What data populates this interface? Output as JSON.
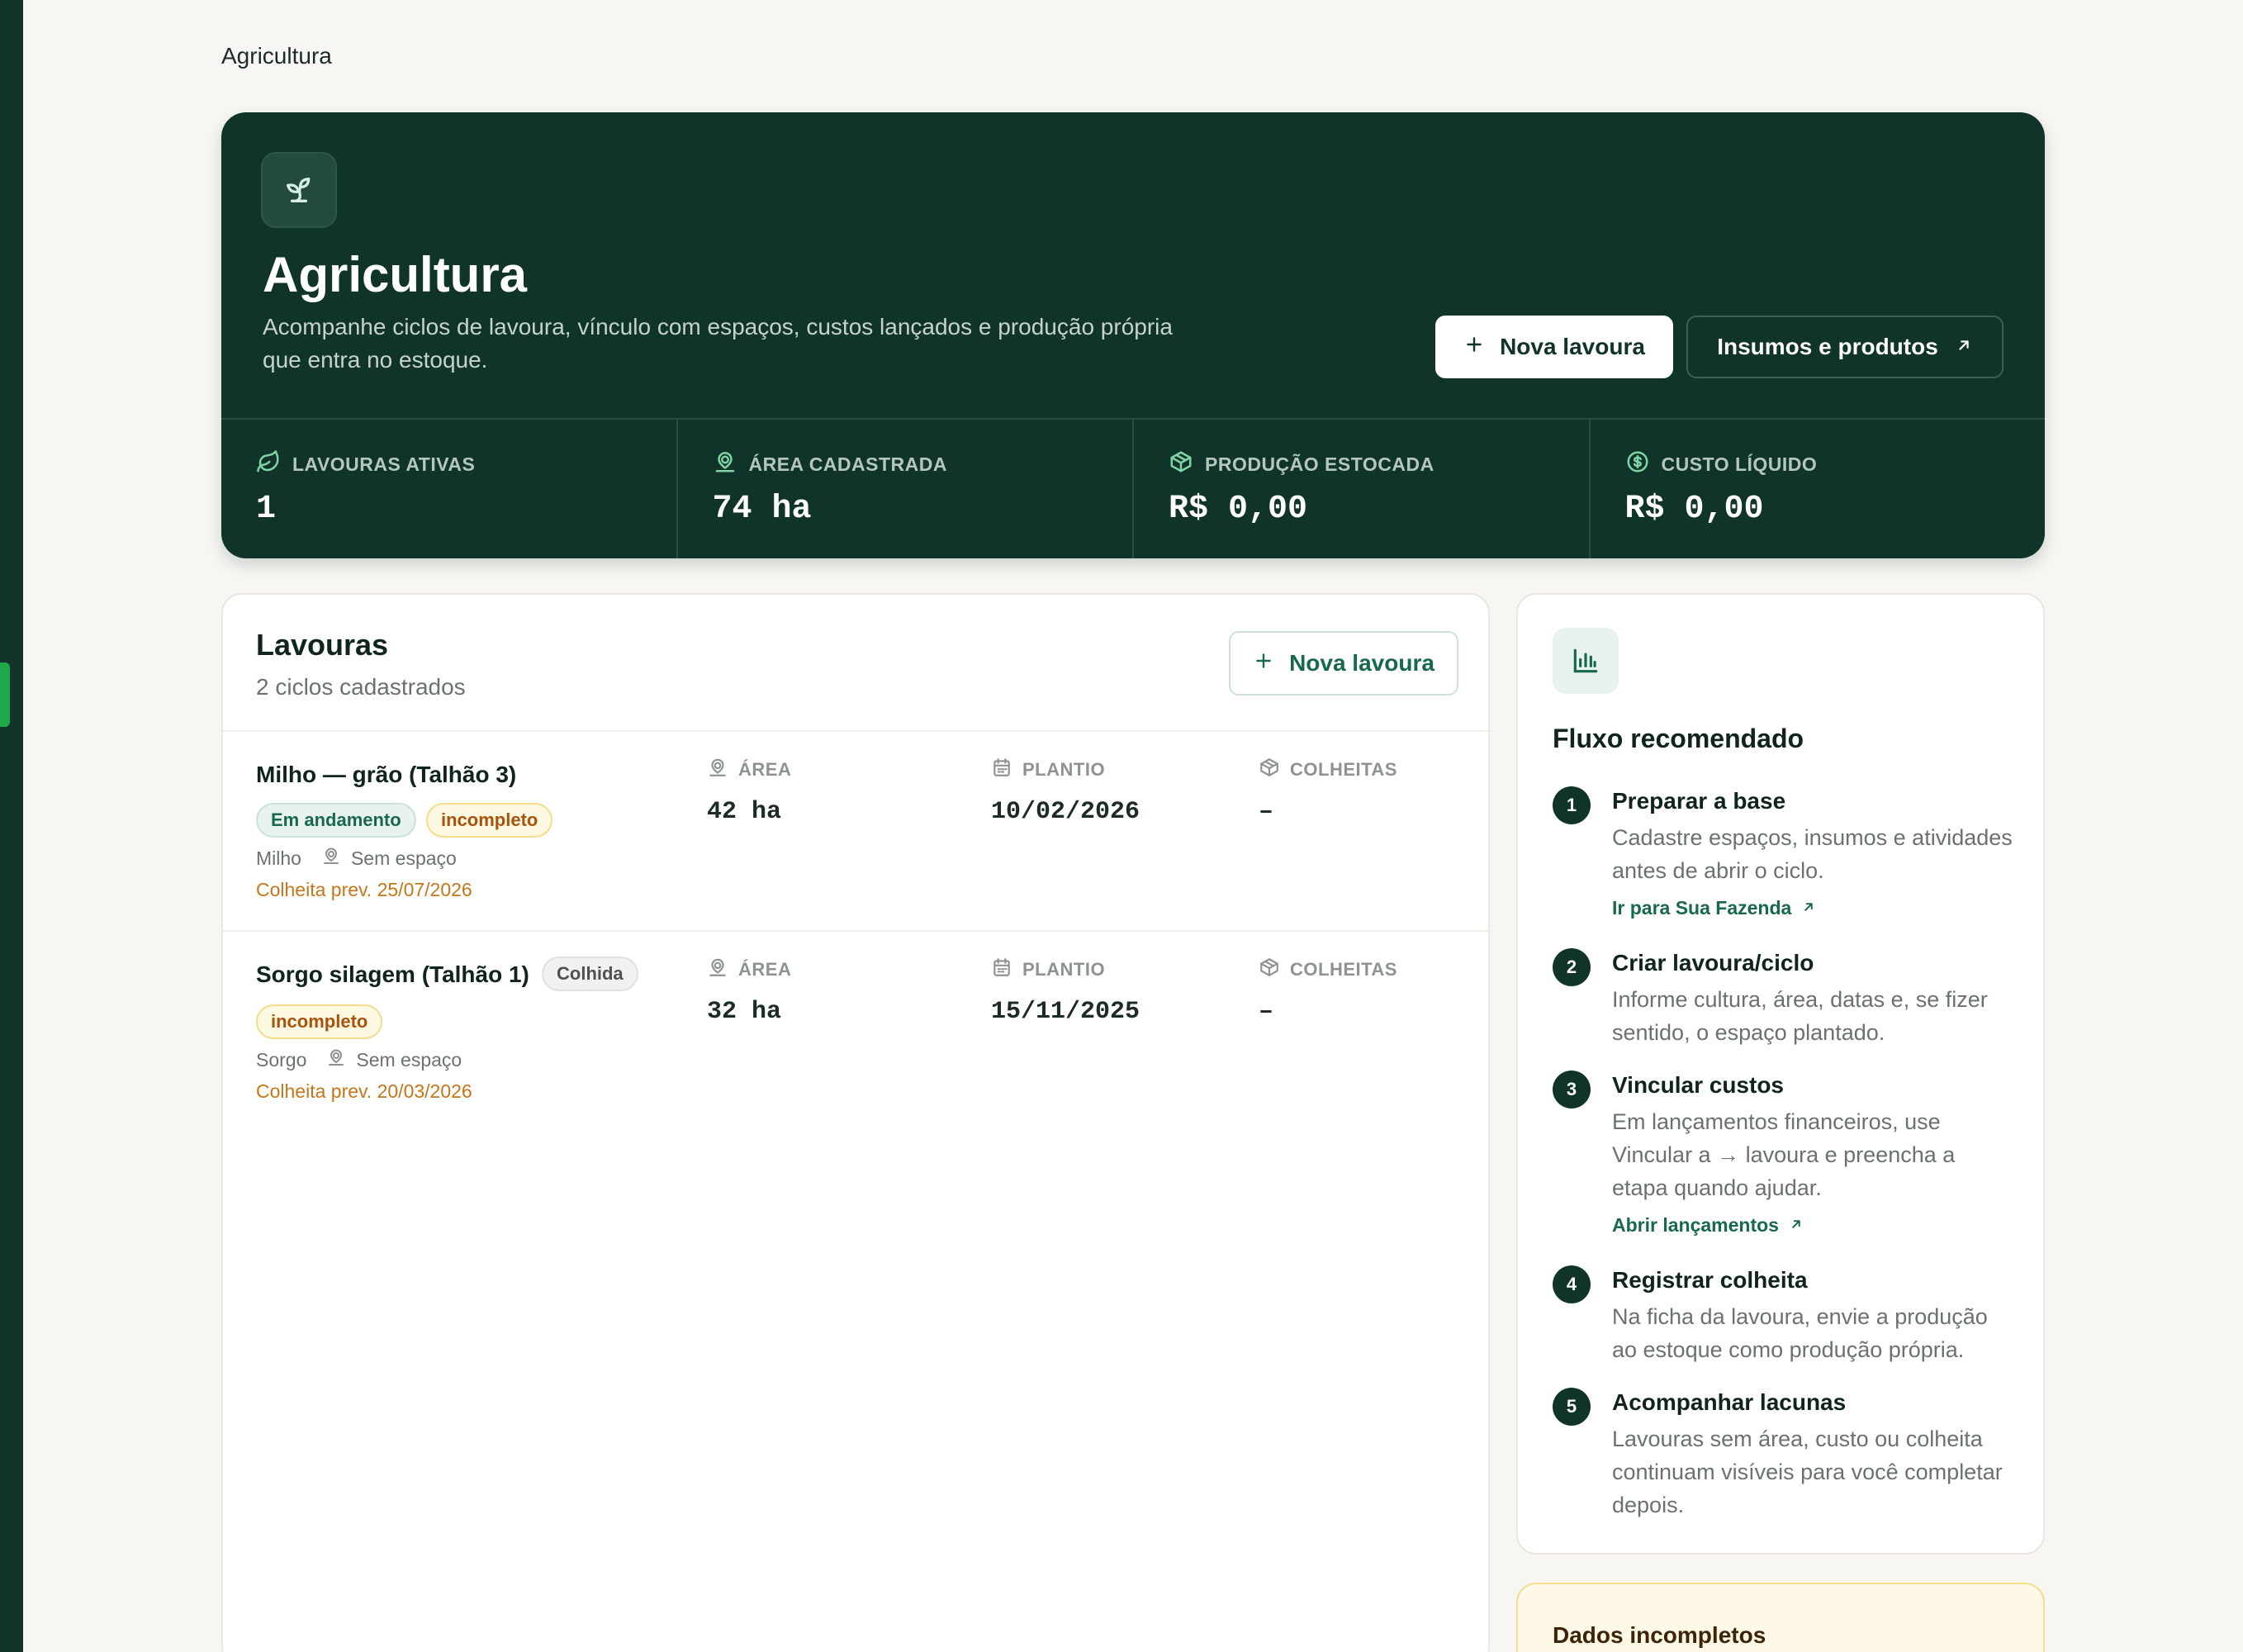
{
  "breadcrumb": "Agricultura",
  "hero": {
    "title": "Agricultura",
    "description": "Acompanhe ciclos de lavoura, vínculo com espaços, custos lançados e produção própria que entra no estoque.",
    "primary_button": "Nova lavoura",
    "secondary_button": "Insumos e produtos",
    "icon": "sprout-icon"
  },
  "stats": [
    {
      "label": "LAVOURAS ATIVAS",
      "value": "1",
      "icon": "leaf-icon"
    },
    {
      "label": "ÁREA CADASTRADA",
      "value": "74 ha",
      "icon": "map-pin-icon"
    },
    {
      "label": "PRODUÇÃO ESTOCADA",
      "value": "R$ 0,00",
      "icon": "package-icon"
    },
    {
      "label": "CUSTO LÍQUIDO",
      "value": "R$ 0,00",
      "icon": "dollar-circle-icon"
    }
  ],
  "crops": {
    "title": "Lavouras",
    "subtitle": "2 ciclos cadastrados",
    "new_button": "Nova lavoura",
    "col_labels": {
      "area": "ÁREA",
      "planting": "PLANTIO",
      "harvests": "COLHEITAS"
    },
    "rows": [
      {
        "name": "Milho — grão (Talhão 3)",
        "status": "Em andamento",
        "flag": "incompleto",
        "culture": "Milho",
        "space": "Sem espaço",
        "harvest_forecast": "Colheita prev. 25/07/2026",
        "area": "42 ha",
        "planting": "10/02/2026",
        "harvests": "–"
      },
      {
        "name": "Sorgo silagem (Talhão 1)",
        "status": "Colhida",
        "flag": "incompleto",
        "culture": "Sorgo",
        "space": "Sem espaço",
        "harvest_forecast": "Colheita prev. 20/03/2026",
        "area": "32 ha",
        "planting": "15/11/2025",
        "harvests": "–"
      }
    ]
  },
  "flow": {
    "title": "Fluxo recomendado",
    "steps": [
      {
        "num": "1",
        "title": "Preparar a base",
        "desc": "Cadastre espaços, insumos e atividades antes de abrir o ciclo.",
        "link": "Ir para Sua Fazenda"
      },
      {
        "num": "2",
        "title": "Criar lavoura/ciclo",
        "desc": "Informe cultura, área, datas e, se fizer sentido, o espaço plantado."
      },
      {
        "num": "3",
        "title": "Vincular custos",
        "desc": "Em lançamentos financeiros, use Vincular a → lavoura e preencha a etapa quando ajudar.",
        "link": "Abrir lançamentos"
      },
      {
        "num": "4",
        "title": "Registrar colheita",
        "desc": "Na ficha da lavoura, envie a produção ao estoque como produção própria."
      },
      {
        "num": "5",
        "title": "Acompanhar lacunas",
        "desc": "Lavouras sem área, custo ou colheita continuam visíveis para você completar depois."
      }
    ]
  },
  "warning": {
    "title": "Dados incompletos"
  },
  "colors": {
    "brand_dark": "#10342a",
    "accent_green": "#17694a",
    "amber": "#c7751a",
    "rail_active": "#1fa84a"
  }
}
